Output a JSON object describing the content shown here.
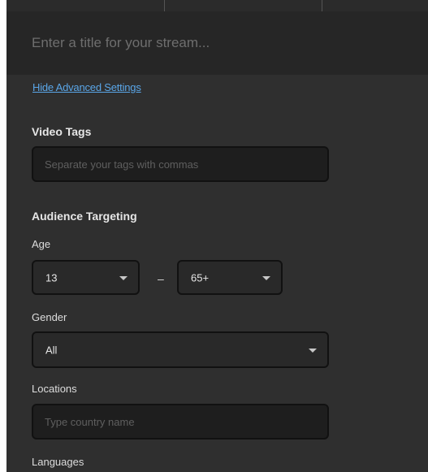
{
  "stream": {
    "title_placeholder": "Enter a title for your stream..."
  },
  "advanced": {
    "hide_link_label": "Hide Advanced Settings"
  },
  "video_tags": {
    "heading": "Video Tags",
    "placeholder": "Separate your tags with commas"
  },
  "audience": {
    "heading": "Audience Targeting",
    "age": {
      "label": "Age",
      "min_value": "13",
      "separator": "–",
      "max_value": "65+"
    },
    "gender": {
      "label": "Gender",
      "value": "All"
    },
    "locations": {
      "label": "Locations",
      "placeholder": "Type country name"
    },
    "languages": {
      "label": "Languages"
    }
  },
  "icons": {
    "dropdown": "chevron-down-icon"
  },
  "colors": {
    "panel_background": "#2f2f2f",
    "input_background": "#1e1e1e",
    "link": "#5aa6e8"
  }
}
